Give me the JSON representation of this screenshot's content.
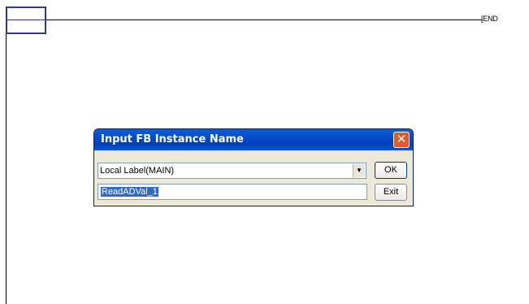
{
  "ladder": {
    "end_label": "END"
  },
  "dialog": {
    "title": "Input FB Instance Name",
    "close_symbol": "✕",
    "label_scope_select": "Local Label(MAIN)",
    "instance_name_value": "ReadADVal_1",
    "ok_label": "OK",
    "exit_label": "Exit"
  },
  "colors": {
    "titlebar": "#0347c7",
    "close_button": "#e05a2b",
    "selection": "#316ac5",
    "cursor_box": "#2c3a8c"
  }
}
